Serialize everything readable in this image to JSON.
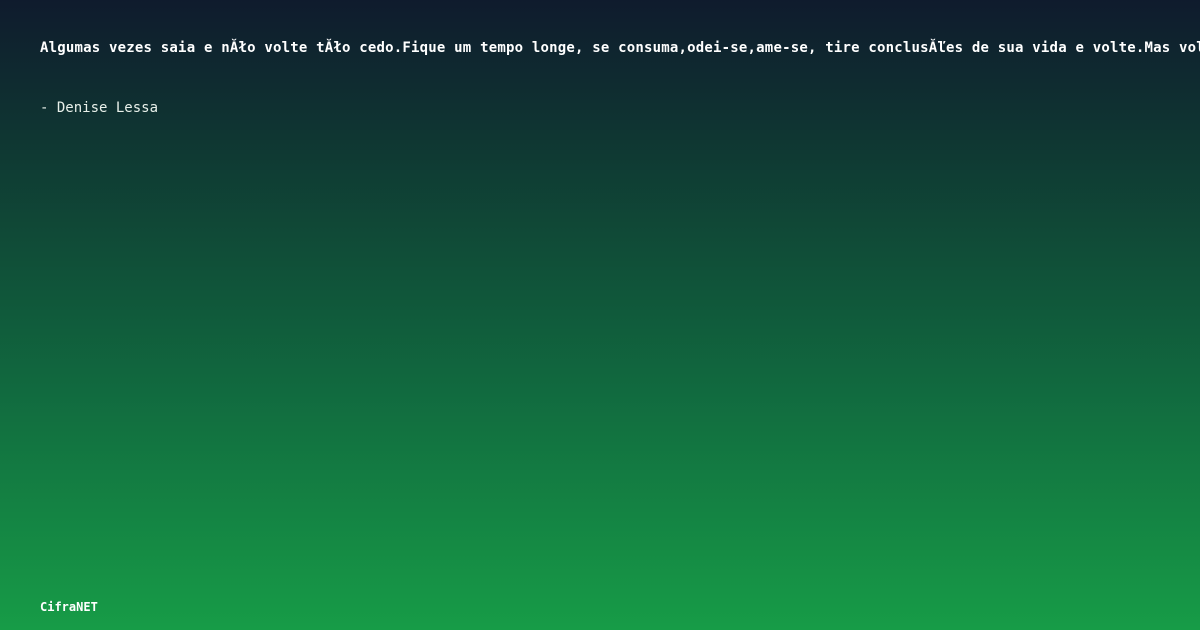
{
  "quote": {
    "text": "Algumas vezes saia e nĂło volte tĂło cedo.Fique um tempo longe, se consuma,odei-se,ame-se, tire conclusĂľes de sua vida e volte.Mas volte melhor"
  },
  "author": {
    "line": "- Denise Lessa"
  },
  "brand": {
    "name": "CifraNET"
  },
  "colors": {
    "gradient_top": "#0f1b2d",
    "gradient_bottom": "#179c47",
    "text": "#ffffff"
  }
}
